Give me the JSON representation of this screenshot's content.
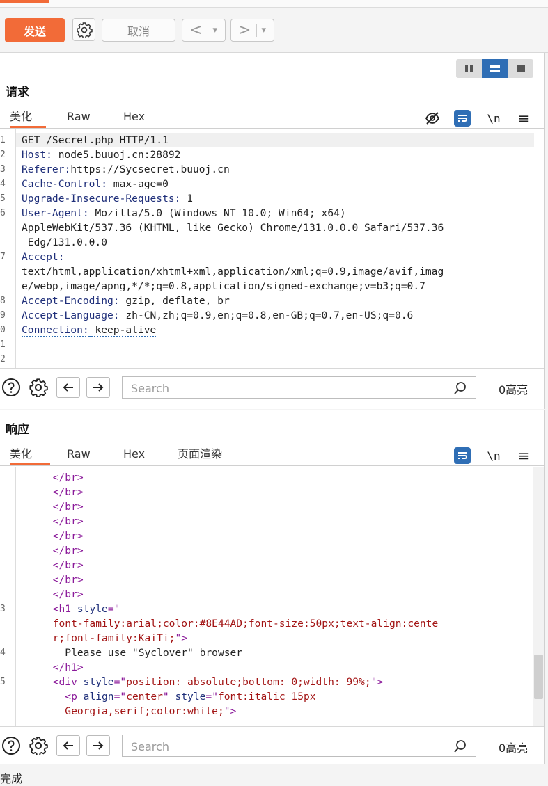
{
  "toolbar": {
    "send_label": "发送",
    "cancel_label": "取消",
    "back_label": "<",
    "forward_label": ">",
    "dropdown_glyph": "▾"
  },
  "request": {
    "title": "请求",
    "tabs": [
      "美化",
      "Raw",
      "Hex"
    ],
    "active_tab": "美化",
    "lines": [
      {
        "n": "1",
        "key": "",
        "val": "GET /Secret.php HTTP/1.1"
      },
      {
        "n": "2",
        "key": "Host:",
        "val": " node5.buuoj.cn:28892"
      },
      {
        "n": "3",
        "key": "Referer:",
        "val": "https://Sycsecret.buuoj.cn"
      },
      {
        "n": "4",
        "key": "Cache-Control:",
        "val": " max-age=0"
      },
      {
        "n": "5",
        "key": "Upgrade-Insecure-Requests:",
        "val": " 1"
      },
      {
        "n": "6",
        "key": "User-Agent:",
        "val": " Mozilla/5.0 (Windows NT 10.0; Win64; x64)"
      },
      {
        "n": "",
        "key": "",
        "val": "AppleWebKit/537.36 (KHTML, like Gecko) Chrome/131.0.0.0 Safari/537.36"
      },
      {
        "n": "",
        "key": "",
        "val": " Edg/131.0.0.0"
      },
      {
        "n": "7",
        "key": "Accept:",
        "val": ""
      },
      {
        "n": "",
        "key": "",
        "val": "text/html,application/xhtml+xml,application/xml;q=0.9,image/avif,imag"
      },
      {
        "n": "",
        "key": "",
        "val": "e/webp,image/apng,*/*;q=0.8,application/signed-exchange;v=b3;q=0.7"
      },
      {
        "n": "8",
        "key": "Accept-Encoding:",
        "val": " gzip, deflate, br"
      },
      {
        "n": "9",
        "key": "Accept-Language:",
        "val": " zh-CN,zh;q=0.9,en;q=0.8,en-GB;q=0.7,en-US;q=0.6"
      },
      {
        "n": "0",
        "key": "Connection:",
        "val": " keep-alive"
      },
      {
        "n": "1",
        "key": "",
        "val": ""
      },
      {
        "n": "2",
        "key": "",
        "val": ""
      }
    ]
  },
  "response": {
    "title": "响应",
    "tabs": [
      "美化",
      "Raw",
      "Hex",
      "页面渲染"
    ],
    "active_tab": "美化",
    "lines": [
      {
        "n": "",
        "segs": [
          [
            "tag",
            "      </br>"
          ]
        ]
      },
      {
        "n": "",
        "segs": [
          [
            "tag",
            "      </br>"
          ]
        ]
      },
      {
        "n": "",
        "segs": [
          [
            "tag",
            "      </br>"
          ]
        ]
      },
      {
        "n": "",
        "segs": [
          [
            "tag",
            "      </br>"
          ]
        ]
      },
      {
        "n": "",
        "segs": [
          [
            "tag",
            "      </br>"
          ]
        ]
      },
      {
        "n": "",
        "segs": [
          [
            "tag",
            "      </br>"
          ]
        ]
      },
      {
        "n": "",
        "segs": [
          [
            "tag",
            "      </br>"
          ]
        ]
      },
      {
        "n": "",
        "segs": [
          [
            "tag",
            "      </br>"
          ]
        ]
      },
      {
        "n": "",
        "segs": [
          [
            "tag",
            "      </br>"
          ]
        ]
      },
      {
        "n": "3",
        "segs": [
          [
            "tag",
            "      <h1 "
          ],
          [
            "attr",
            "style"
          ],
          [
            "tag",
            "=\""
          ]
        ]
      },
      {
        "n": "",
        "segs": [
          [
            "str",
            "      font-family:arial;color:#8E44AD;font-size:50px;text-align:cente"
          ]
        ]
      },
      {
        "n": "",
        "segs": [
          [
            "str",
            "      r;font-family:KaiTi;"
          ],
          [
            "tag",
            "\">"
          ]
        ]
      },
      {
        "n": "4",
        "segs": [
          [
            "txt",
            "        Please use \"Syclover\" browser"
          ]
        ]
      },
      {
        "n": "",
        "segs": [
          [
            "tag",
            "      </h1>"
          ]
        ]
      },
      {
        "n": "5",
        "segs": [
          [
            "tag",
            "      <div "
          ],
          [
            "attr",
            "style"
          ],
          [
            "tag",
            "=\""
          ],
          [
            "str",
            "position: absolute;bottom: 0;width: 99%;"
          ],
          [
            "tag",
            "\">"
          ]
        ]
      },
      {
        "n": "",
        "segs": [
          [
            "tag",
            "        <p "
          ],
          [
            "attr",
            "align"
          ],
          [
            "tag",
            "=\""
          ],
          [
            "str",
            "center"
          ],
          [
            "tag",
            "\" "
          ],
          [
            "attr",
            "style"
          ],
          [
            "tag",
            "=\""
          ],
          [
            "str",
            "font:italic 15px"
          ]
        ]
      },
      {
        "n": "",
        "segs": [
          [
            "str",
            "        Georgia,serif;color:white;"
          ],
          [
            "tag",
            "\">"
          ]
        ]
      }
    ]
  },
  "search": {
    "placeholder": "Search",
    "count_label": "0高亮"
  },
  "status": {
    "text": "完成"
  },
  "colors": {
    "accent": "#f26b38",
    "blue": "#2f6eb5"
  }
}
